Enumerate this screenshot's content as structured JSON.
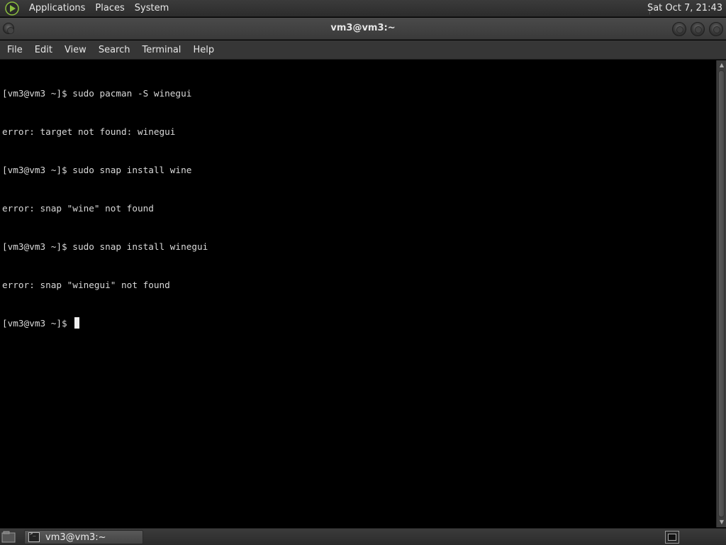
{
  "top_panel": {
    "menus": [
      "Applications",
      "Places",
      "System"
    ],
    "clock": "Sat Oct  7, 21:43"
  },
  "window": {
    "title": "vm3@vm3:~",
    "menubar": [
      "File",
      "Edit",
      "View",
      "Search",
      "Terminal",
      "Help"
    ]
  },
  "terminal": {
    "lines": [
      "[vm3@vm3 ~]$ sudo pacman -S winegui",
      "error: target not found: winegui",
      "[vm3@vm3 ~]$ sudo snap install wine",
      "error: snap \"wine\" not found",
      "[vm3@vm3 ~]$ sudo snap install winegui",
      "error: snap \"winegui\" not found"
    ],
    "prompt": "[vm3@vm3 ~]$ "
  },
  "taskbar": {
    "task_label": "vm3@vm3:~"
  },
  "icons": {
    "logo": "distro-logo-icon",
    "show_desktop": "show-desktop-icon",
    "terminal": "terminal-icon",
    "workspace": "workspace-switcher-icon"
  },
  "colors": {
    "accent": "#8bbf3f",
    "terminal_bg": "#000000",
    "terminal_fg": "#d9d9d9"
  }
}
